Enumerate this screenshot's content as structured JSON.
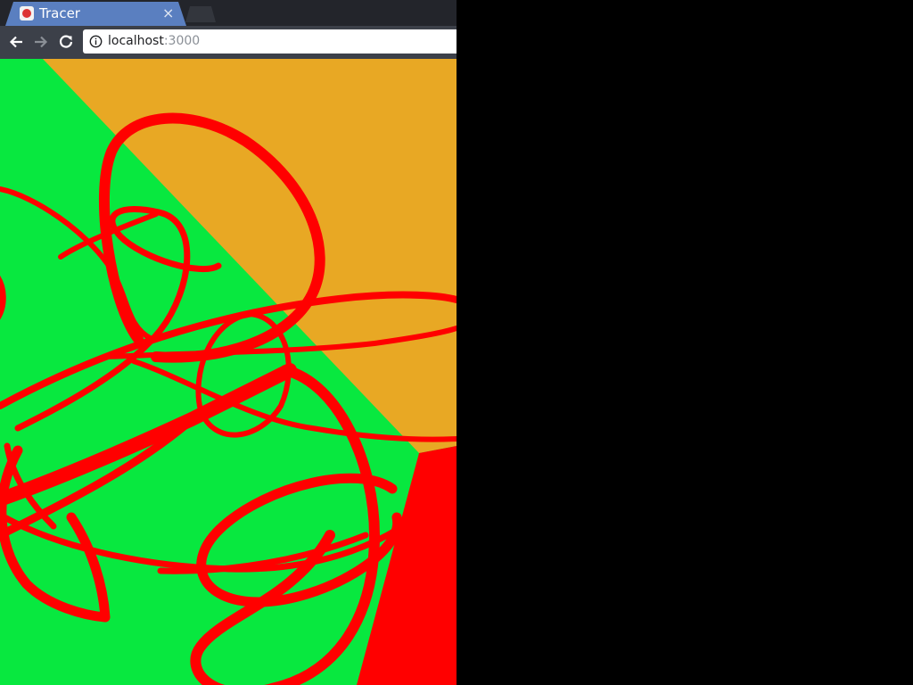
{
  "tab": {
    "title": "Tracer",
    "close_glyph": "×",
    "favicon": "heart-favicon-icon"
  },
  "toolbar": {
    "back_icon": "back-arrow-icon",
    "forward_icon": "forward-arrow-icon",
    "reload_icon": "reload-icon",
    "address": {
      "host": "localhost",
      "port": ":3000",
      "site_info_icon": "info-icon"
    }
  },
  "canvas": {
    "colors": {
      "green": "#08e83f",
      "orange": "#e8a824",
      "red": "#ff0000"
    }
  }
}
